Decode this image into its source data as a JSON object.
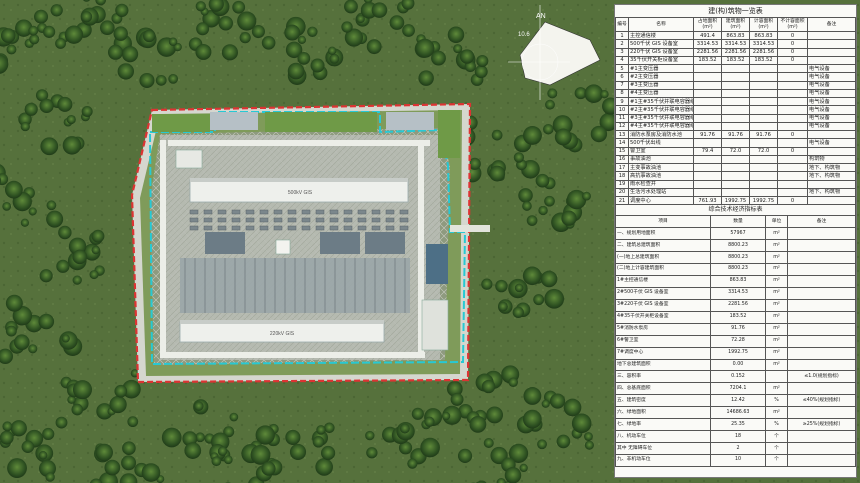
{
  "compass": {
    "north_label": "AN",
    "angle_label": "10.6"
  },
  "table1": {
    "title": "建(构)筑物一览表",
    "headers": [
      "编号",
      "名称",
      "占地面积\n(m²)",
      "建筑面积\n(m²)",
      "计容面积\n(m²)",
      "不计容面积\n(m²)",
      "备注"
    ],
    "rows": [
      [
        "1",
        "主控通信楼",
        "491.4",
        "863.83",
        "863.83",
        "0",
        ""
      ],
      [
        "2",
        "500千伏 GIS 设备室",
        "3314.53",
        "3314.53",
        "3314.53",
        "0",
        ""
      ],
      [
        "3",
        "220千伏 GIS 设备室",
        "2281.56",
        "2281.56",
        "2281.56",
        "0",
        ""
      ],
      [
        "4",
        "35千伏开关柜设备室",
        "183.52",
        "183.52",
        "183.52",
        "0",
        ""
      ],
      [
        "5",
        "#1主变压器",
        "",
        "",
        "",
        "",
        "电气设备"
      ],
      [
        "6",
        "#2主变压器",
        "",
        "",
        "",
        "",
        "电气设备"
      ],
      [
        "7",
        "#3主变压器",
        "",
        "",
        "",
        "",
        "电气设备"
      ],
      [
        "8",
        "#4主变压器",
        "",
        "",
        "",
        "",
        "电气设备"
      ],
      [
        "9",
        "#1主#35千伏并联电容器组",
        "",
        "",
        "",
        "",
        "电气设备"
      ],
      [
        "10",
        "#2主#35千伏并联电容器组",
        "",
        "",
        "",
        "",
        "电气设备"
      ],
      [
        "11",
        "#3主#35千伏并联电容器组",
        "",
        "",
        "",
        "",
        "电气设备"
      ],
      [
        "12",
        "#4主#35千伏并联电容器组",
        "",
        "",
        "",
        "",
        "电气设备"
      ],
      [
        "13",
        "消防水泵房及消防水池",
        "91.76",
        "91.76",
        "91.76",
        "0",
        ""
      ],
      [
        "14",
        "500千伏出线",
        "",
        "",
        "",
        "",
        "电气设备"
      ],
      [
        "15",
        "警卫室",
        "79.4",
        "72.0",
        "72.0",
        "0",
        ""
      ],
      [
        "16",
        "事故油池",
        "",
        "",
        "",
        "",
        "构筑物"
      ],
      [
        "17",
        "主变事故油池",
        "",
        "",
        "",
        "",
        "地下、构筑物"
      ],
      [
        "18",
        "高抗事故油池",
        "",
        "",
        "",
        "",
        "地下、构筑物"
      ],
      [
        "19",
        "雨水检查井",
        "",
        "",
        "",
        "",
        ""
      ],
      [
        "20",
        "生活污水处理站",
        "",
        "",
        "",
        "",
        "地下、构筑物"
      ],
      [
        "21",
        "调度中心",
        "761.93",
        "1992.75",
        "1992.75",
        "0",
        ""
      ]
    ]
  },
  "table2": {
    "title": "综合技术经济指标表",
    "headers": [
      "项目",
      "数量",
      "单位",
      "备注"
    ],
    "rows": [
      {
        "label": "一、规划用地面积",
        "value": "57967",
        "unit": "m²",
        "note": ""
      },
      {
        "label": "二、建筑总建筑面积",
        "value": "8800.23",
        "unit": "m²",
        "note": ""
      },
      {
        "label": "(一)地上总建筑面积",
        "value": "8800.23",
        "unit": "m²",
        "note": ""
      },
      {
        "label": "(二)地上计容建筑面积",
        "value": "8800.23",
        "unit": "m²",
        "note": ""
      },
      {
        "label": "1#主控通信楼",
        "value": "863.83",
        "unit": "m²",
        "note": ""
      },
      {
        "label": "2#500千伏 GIS 设备室",
        "value": "3314.53",
        "unit": "m²",
        "note": ""
      },
      {
        "label": "3#220千伏 GIS 设备室",
        "value": "2281.56",
        "unit": "m²",
        "note": ""
      },
      {
        "label": "4#35千伏开关柜设备室",
        "value": "183.52",
        "unit": "m²",
        "note": ""
      },
      {
        "label": "5#消防水泵房",
        "value": "91.76",
        "unit": "m²",
        "note": ""
      },
      {
        "label": "6#警卫室",
        "value": "72.28",
        "unit": "m²",
        "note": ""
      },
      {
        "label": "7#调度中心",
        "value": "1992.75",
        "unit": "m²",
        "note": ""
      },
      {
        "label": "地下总建筑面积",
        "value": "0.00",
        "unit": "m²",
        "note": ""
      },
      {
        "label": "三、容积率",
        "value": "0.152",
        "unit": "",
        "note": "≤1.0(规划指标)"
      },
      {
        "label": "四、总基底面积",
        "value": "7204.1",
        "unit": "m²",
        "note": ""
      },
      {
        "label": "五、建筑密度",
        "value": "12.42",
        "unit": "%",
        "note": "≤40%(规划指标)"
      },
      {
        "label": "六、绿地面积",
        "value": "14686.63",
        "unit": "m²",
        "note": ""
      },
      {
        "label": "七、绿地率",
        "value": "25.35",
        "unit": "%",
        "note": "≥25%(规划指标)"
      },
      {
        "label": "八、机动车位",
        "value": "18",
        "unit": "个",
        "note": ""
      },
      {
        "label": "其中 无障碍车位",
        "value": "2",
        "unit": "个",
        "note": ""
      },
      {
        "label": "九、非机动车位",
        "value": "10",
        "unit": "个",
        "note": ""
      }
    ],
    "subgroup_label": "其中"
  },
  "site": {
    "building_labels": [
      "500kV GIS",
      "220kV GIS"
    ]
  }
}
